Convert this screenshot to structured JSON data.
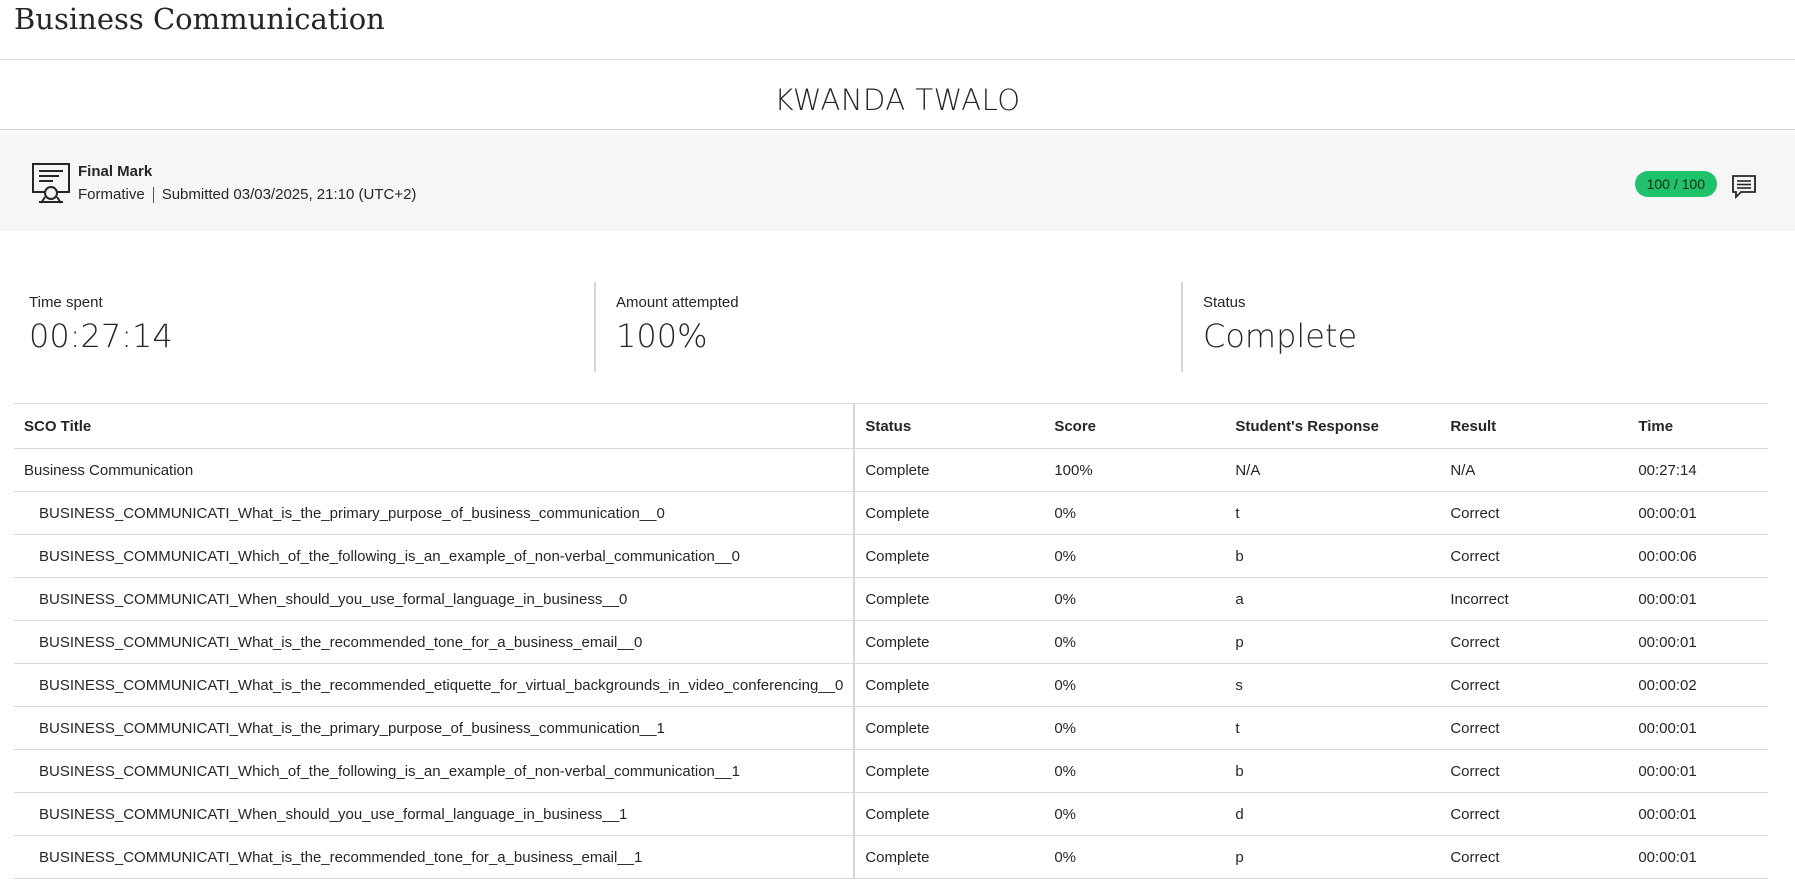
{
  "course": {
    "title": "Business Communication"
  },
  "student": {
    "name": "KWANDA TWALO"
  },
  "final_mark": {
    "title": "Final Mark",
    "type": "Formative",
    "submitted": "Submitted 03/03/2025, 21:10 (UTC+2)",
    "grade": "100 / 100",
    "grade_color": "#1ec26b",
    "icon": "certificate-icon",
    "feedback_icon": "feedback-comment-icon"
  },
  "stats": [
    {
      "label": "Time spent",
      "value": "00:27:14"
    },
    {
      "label": "Amount attempted",
      "value": "100%"
    },
    {
      "label": "Status",
      "value": "Complete"
    }
  ],
  "table": {
    "headers": [
      "SCO Title",
      "Status",
      "Score",
      "Student's Response",
      "Result",
      "Time"
    ],
    "rows": [
      {
        "title": "Business Communication",
        "status": "Complete",
        "score": "100%",
        "response": "N/A",
        "result": "N/A",
        "time": "00:27:14"
      },
      {
        "title": "BUSINESS_COMMUNICATI_What_is_the_primary_purpose_of_business_communication__0",
        "status": "Complete",
        "score": "0%",
        "response": "t",
        "result": "Correct",
        "time": "00:00:01"
      },
      {
        "title": "BUSINESS_COMMUNICATI_Which_of_the_following_is_an_example_of_non-verbal_communication__0",
        "status": "Complete",
        "score": "0%",
        "response": "b",
        "result": "Correct",
        "time": "00:00:06"
      },
      {
        "title": "BUSINESS_COMMUNICATI_When_should_you_use_formal_language_in_business__0",
        "status": "Complete",
        "score": "0%",
        "response": "a",
        "result": "Incorrect",
        "time": "00:00:01"
      },
      {
        "title": "BUSINESS_COMMUNICATI_What_is_the_recommended_tone_for_a_business_email__0",
        "status": "Complete",
        "score": "0%",
        "response": "p",
        "result": "Correct",
        "time": "00:00:01"
      },
      {
        "title": "BUSINESS_COMMUNICATI_What_is_the_recommended_etiquette_for_virtual_backgrounds_in_video_conferencing__0",
        "status": "Complete",
        "score": "0%",
        "response": "s",
        "result": "Correct",
        "time": "00:00:02"
      },
      {
        "title": "BUSINESS_COMMUNICATI_What_is_the_primary_purpose_of_business_communication__1",
        "status": "Complete",
        "score": "0%",
        "response": "t",
        "result": "Correct",
        "time": "00:00:01"
      },
      {
        "title": "BUSINESS_COMMUNICATI_Which_of_the_following_is_an_example_of_non-verbal_communication__1",
        "status": "Complete",
        "score": "0%",
        "response": "b",
        "result": "Correct",
        "time": "00:00:01"
      },
      {
        "title": "BUSINESS_COMMUNICATI_When_should_you_use_formal_language_in_business__1",
        "status": "Complete",
        "score": "0%",
        "response": "d",
        "result": "Correct",
        "time": "00:00:01"
      },
      {
        "title": "BUSINESS_COMMUNICATI_What_is_the_recommended_tone_for_a_business_email__1",
        "status": "Complete",
        "score": "0%",
        "response": "p",
        "result": "Correct",
        "time": "00:00:01"
      }
    ]
  }
}
